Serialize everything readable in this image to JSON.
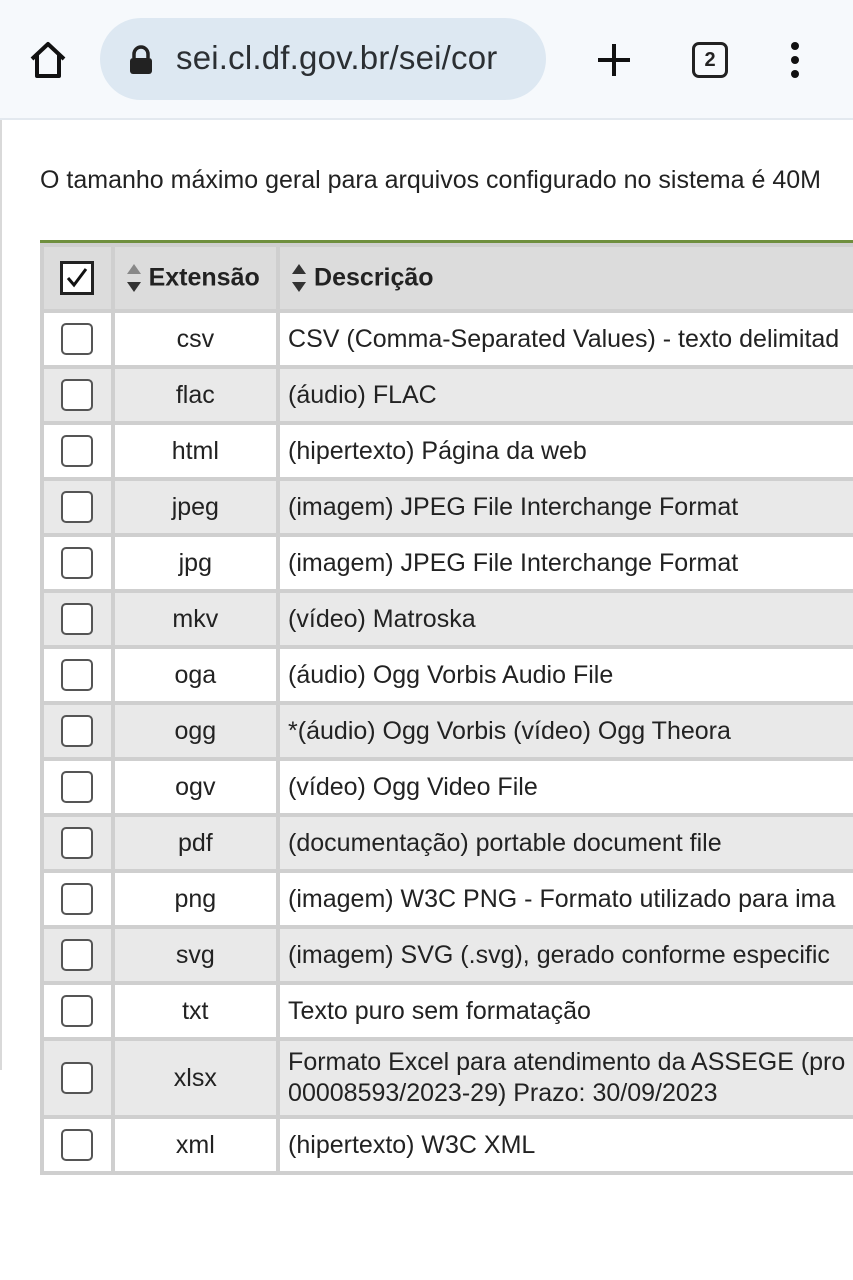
{
  "browser": {
    "url": "sei.cl.df.gov.br/sei/cor",
    "tab_count": "2"
  },
  "page": {
    "info_text": "O tamanho máximo geral para arquivos configurado no sistema é 40M"
  },
  "table": {
    "headers": {
      "extension": "Extensão",
      "description": "Descrição"
    },
    "rows": [
      {
        "ext": "csv",
        "desc": "CSV (Comma-Separated Values) - texto delimitad"
      },
      {
        "ext": "flac",
        "desc": "(áudio) FLAC"
      },
      {
        "ext": "html",
        "desc": "(hipertexto) Página da web"
      },
      {
        "ext": "jpeg",
        "desc": "(imagem) JPEG File Interchange Format"
      },
      {
        "ext": "jpg",
        "desc": "(imagem) JPEG File Interchange Format"
      },
      {
        "ext": "mkv",
        "desc": "(vídeo) Matroska"
      },
      {
        "ext": "oga",
        "desc": "(áudio) Ogg Vorbis Audio File"
      },
      {
        "ext": "ogg",
        "desc": "*(áudio) Ogg Vorbis (vídeo) Ogg Theora"
      },
      {
        "ext": "ogv",
        "desc": "(vídeo) Ogg Video File"
      },
      {
        "ext": "pdf",
        "desc": "(documentação) portable document file"
      },
      {
        "ext": "png",
        "desc": "(imagem) W3C PNG - Formato utilizado para ima"
      },
      {
        "ext": "svg",
        "desc": "(imagem) SVG (.svg), gerado conforme especific"
      },
      {
        "ext": "txt",
        "desc": "Texto puro sem formatação"
      },
      {
        "ext": "xlsx",
        "desc": "Formato Excel para atendimento da ASSEGE (pro 00008593/2023-29) Prazo: 30/09/2023"
      },
      {
        "ext": "xml",
        "desc": "(hipertexto) W3C XML"
      }
    ]
  }
}
